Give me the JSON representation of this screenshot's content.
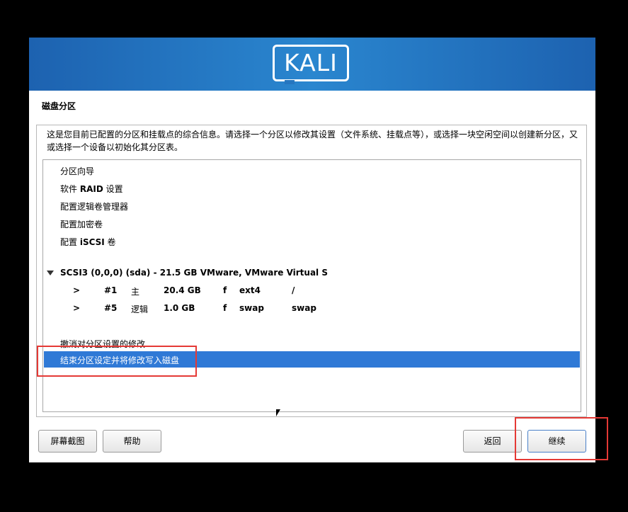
{
  "banner": {
    "logo_text": "KALI"
  },
  "page": {
    "title": "磁盘分区"
  },
  "description": "这是您目前已配置的分区和挂载点的综合信息。请选择一个分区以修改其设置（文件系统、挂载点等），或选择一块空闲空间以创建新分区，又或选择一个设备以初始化其分区表。",
  "menu_items": [
    {
      "text": "分区向导"
    },
    {
      "prefix": "软件 ",
      "bold": "RAID",
      "suffix": " 设置"
    },
    {
      "text": "配置逻辑卷管理器"
    },
    {
      "text": "配置加密卷"
    },
    {
      "prefix": "配置 ",
      "bold": "iSCSI",
      "suffix": " 卷"
    }
  ],
  "disk": {
    "header": "SCSI3 (0,0,0) (sda) - 21.5 GB VMware, VMware Virtual S",
    "partitions": [
      {
        "arrow": ">",
        "num": "#1",
        "type": "主",
        "size": "20.4 GB",
        "flag": "f",
        "fs": "ext4",
        "mount": "/"
      },
      {
        "arrow": ">",
        "num": "#5",
        "type": "逻辑",
        "size": "1.0 GB",
        "flag": "f",
        "fs": "swap",
        "mount": "swap"
      }
    ]
  },
  "actions": {
    "undo": "撤消对分区设置的修改",
    "finish": "结束分区设定并将修改写入磁盘"
  },
  "buttons": {
    "screenshot": "屏幕截图",
    "help": "帮助",
    "back": "返回",
    "continue": "继续"
  },
  "colors": {
    "banner": "#2576c0",
    "selection": "#2f79d6",
    "annotation": "#e53935"
  }
}
